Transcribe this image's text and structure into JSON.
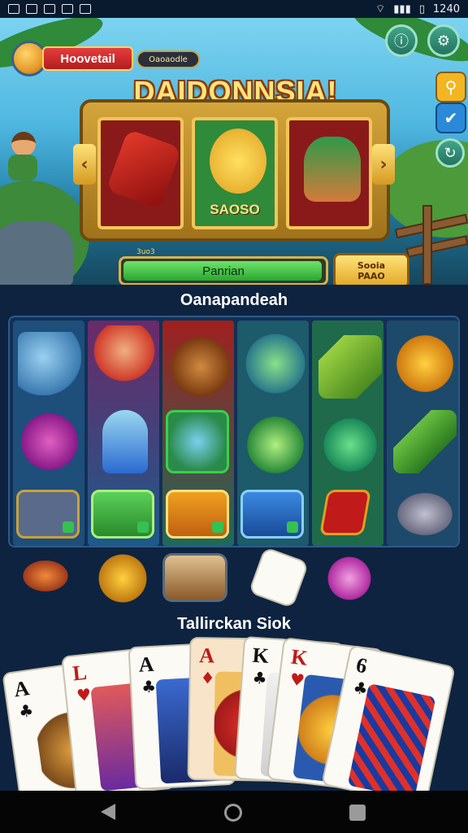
{
  "status_bar": {
    "time": "1240"
  },
  "profile": {
    "name": "Hoovetail",
    "coins": "Oaoaodle"
  },
  "hero": {
    "title": "DAIDONNSIA!",
    "reel_label": "SAOSO",
    "progress": {
      "label": "Panrian",
      "tag": "3uo3",
      "fraction": 0.99
    },
    "bonus_button": {
      "line1": "Sooia",
      "line2": "PAAO"
    }
  },
  "section_one": {
    "title": "Oanapandeah"
  },
  "section_two": {
    "title": "Tallirckan Siok"
  },
  "cards": [
    {
      "rank": "A",
      "suit": "♣"
    },
    {
      "rank": "L",
      "suit": "♥"
    },
    {
      "rank": "A",
      "suit": "♣"
    },
    {
      "rank": "A",
      "suit": "♦"
    },
    {
      "rank": "K",
      "suit": "♣"
    },
    {
      "rank": "K",
      "suit": "♥"
    },
    {
      "rank": "6",
      "suit": "♣"
    }
  ],
  "colors": {
    "background": "#0d2340",
    "accent_gold": "#d9b24a",
    "progress_green": "#2aa632",
    "name_red": "#e63d3d"
  }
}
